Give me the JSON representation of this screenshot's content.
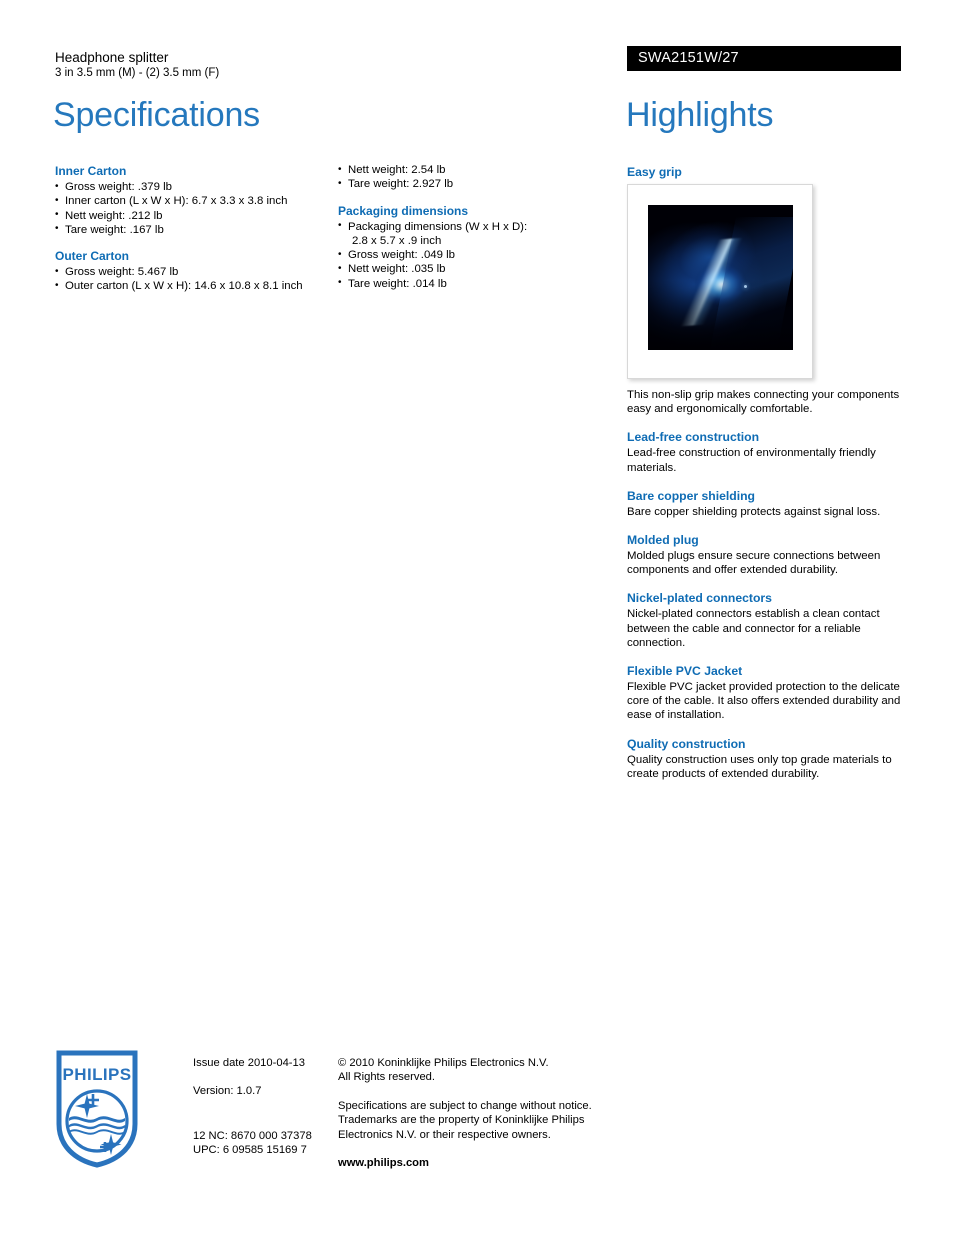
{
  "header": {
    "product_name": "Headphone splitter",
    "product_subtitle": "3 in 3.5 mm (M) - (2) 3.5 mm (F)",
    "model_badge": "SWA2151W/27",
    "specifications_title": "Specifications",
    "highlights_title": "Highlights"
  },
  "colors": {
    "accent_blue": "#0f6cb4",
    "title_blue": "#2578bd",
    "badge_background": "#000000",
    "badge_text": "#ffffff"
  },
  "specifications": {
    "column_1": [
      {
        "title": "Inner Carton",
        "items": [
          "Gross weight: .379 lb",
          "Inner carton (L x W x H): 6.7 x 3.3 x 3.8 inch",
          "Nett weight: .212 lb",
          "Tare weight: .167 lb"
        ]
      },
      {
        "title": "Outer Carton",
        "items": [
          "Gross weight: 5.467 lb",
          "Outer carton (L x W x H): 14.6 x 10.8 x 8.1 inch"
        ]
      }
    ],
    "column_2": [
      {
        "title": "",
        "items": [
          "Nett weight: 2.54 lb",
          "Tare weight: 2.927 lb"
        ]
      },
      {
        "title": "Packaging dimensions",
        "items": [
          "Packaging dimensions (W x H x D):",
          "Gross weight: .049 lb",
          "Nett weight: .035 lb",
          "Tare weight: .014 lb"
        ],
        "continuation": "2.8 x 5.7 x .9 inch"
      }
    ]
  },
  "highlights": [
    {
      "title": "Easy grip",
      "body": "This non-slip grip makes connecting your components easy and ergonomically comfortable.",
      "has_image": true,
      "image_alt": "product-glow-image"
    },
    {
      "title": "Lead-free construction",
      "body": "Lead-free construction of environmentally friendly materials."
    },
    {
      "title": "Bare copper shielding",
      "body": "Bare copper shielding protects against signal loss."
    },
    {
      "title": "Molded plug",
      "body": "Molded plugs ensure secure connections between components and offer extended durability."
    },
    {
      "title": "Nickel-plated connectors",
      "body": "Nickel-plated connectors establish a clean contact between the cable and connector for a reliable connection."
    },
    {
      "title": "Flexible PVC Jacket",
      "body": "Flexible PVC jacket provided protection to the delicate core of the cable. It also offers extended durability and ease of installation."
    },
    {
      "title": "Quality construction",
      "body": "Quality construction uses only top grade materials to create products of extended durability."
    }
  ],
  "footer": {
    "logo_text": "PHILIPS",
    "issue_date": "Issue date 2010-04-13",
    "version": "Version: 1.0.7",
    "nc_code": "12 NC: 8670 000 37378",
    "upc": "UPC: 6 09585 15169 7",
    "copyright_line_1": "© 2010 Koninklijke Philips Electronics N.V.",
    "copyright_line_2": "All Rights reserved.",
    "disclaimer": "Specifications are subject to change without notice. Trademarks are the property of Koninklijke Philips Electronics N.V. or their respective owners.",
    "website": "www.philips.com"
  }
}
